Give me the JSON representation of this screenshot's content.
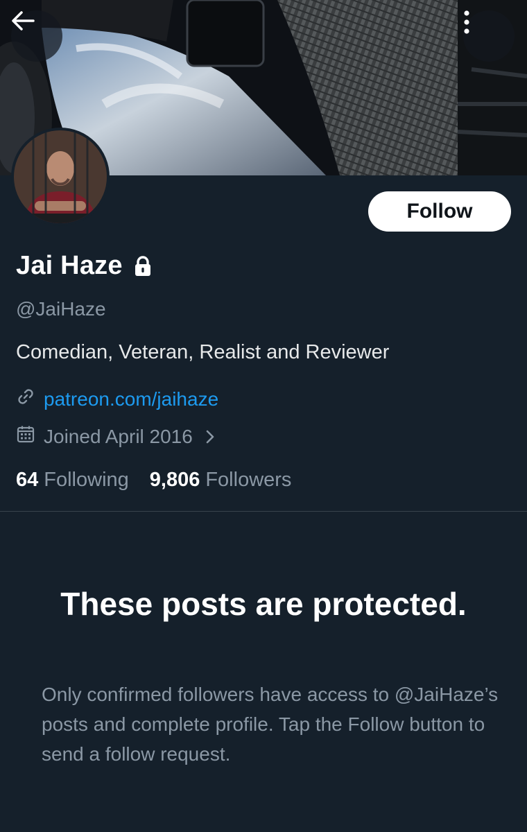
{
  "header": {
    "back_icon": "arrow-left-icon",
    "more_icon": "more-vertical-icon"
  },
  "profile": {
    "display_name": "Jai Haze",
    "lock_icon": "lock-icon",
    "handle": "@JaiHaze",
    "bio": "Comedian, Veteran, Realist and Reviewer",
    "link": "patreon.com/jaihaze",
    "joined": "Joined April 2016",
    "follow_label": "Follow"
  },
  "stats": {
    "following_count": "64",
    "following_label": "Following",
    "followers_count": "9,806",
    "followers_label": "Followers"
  },
  "protected": {
    "title": "These posts are protected.",
    "description": "Only confirmed followers have access to @JaiHaze’s posts and complete profile. Tap the Follow button to send a follow request."
  },
  "colors": {
    "background": "#15202b",
    "link": "#1d9bf0",
    "secondary_text": "#8b98a5",
    "primary_text": "#e7e9ea"
  }
}
